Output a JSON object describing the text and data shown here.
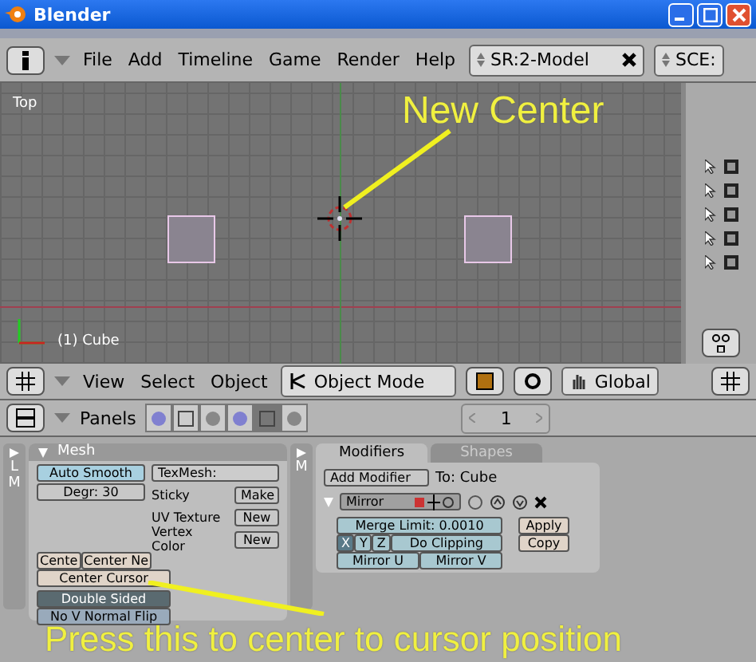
{
  "window": {
    "title": "Blender"
  },
  "top_header": {
    "menus": [
      "File",
      "Add",
      "Timeline",
      "Game",
      "Render",
      "Help"
    ],
    "screen": "SR:2-Model",
    "scene": "SCE:"
  },
  "viewport": {
    "view_name": "Top",
    "object_name": "(1) Cube"
  },
  "viewport_header": {
    "menus": [
      "View",
      "Select",
      "Object"
    ],
    "mode": "Object Mode",
    "orientation": "Global"
  },
  "buttons_header": {
    "label": "Panels",
    "tabs": [
      {
        "selected": false
      },
      {
        "selected": false
      },
      {
        "selected": false
      },
      {
        "selected": false
      },
      {
        "selected": true
      },
      {
        "selected": false
      }
    ],
    "frame": "1"
  },
  "side_tabs": [
    {
      "letters": "L M"
    },
    {
      "letters": "M"
    }
  ],
  "mesh_panel": {
    "title": "Mesh",
    "auto_smooth": {
      "label": "Auto Smooth",
      "on": true
    },
    "degr": "Degr: 30",
    "texmesh": "TexMesh:",
    "rows": [
      {
        "label": "Sticky",
        "button": "Make"
      },
      {
        "label": "UV Texture",
        "button": "New"
      },
      {
        "label": "Vertex Color",
        "button": "New"
      }
    ],
    "center_buttons": [
      "Cente",
      "Center Ne"
    ],
    "center_cursor": "Center Cursor",
    "toggles": [
      {
        "label": "Double Sided",
        "on": true
      },
      {
        "label": "No V Normal Flip",
        "on": false
      }
    ]
  },
  "modifiers_panel": {
    "tabs": [
      {
        "label": "Modifiers",
        "selected": true
      },
      {
        "label": "Shapes",
        "selected": false
      }
    ],
    "add": "Add Modifier",
    "target": "To: Cube",
    "modifier": {
      "name": "Mirror",
      "merge": "Merge Limit: 0.0010",
      "axes": [
        {
          "label": "X",
          "selected": true
        },
        {
          "label": "Y",
          "selected": false
        },
        {
          "label": "Z",
          "selected": false
        }
      ],
      "clipping": "Do Clipping",
      "mirror_u": "Mirror U",
      "mirror_v": "Mirror V",
      "apply": "Apply",
      "copy": "Copy"
    }
  },
  "annotations": [
    {
      "text": "New Center"
    },
    {
      "text": "Press this to center to cursor position"
    }
  ]
}
